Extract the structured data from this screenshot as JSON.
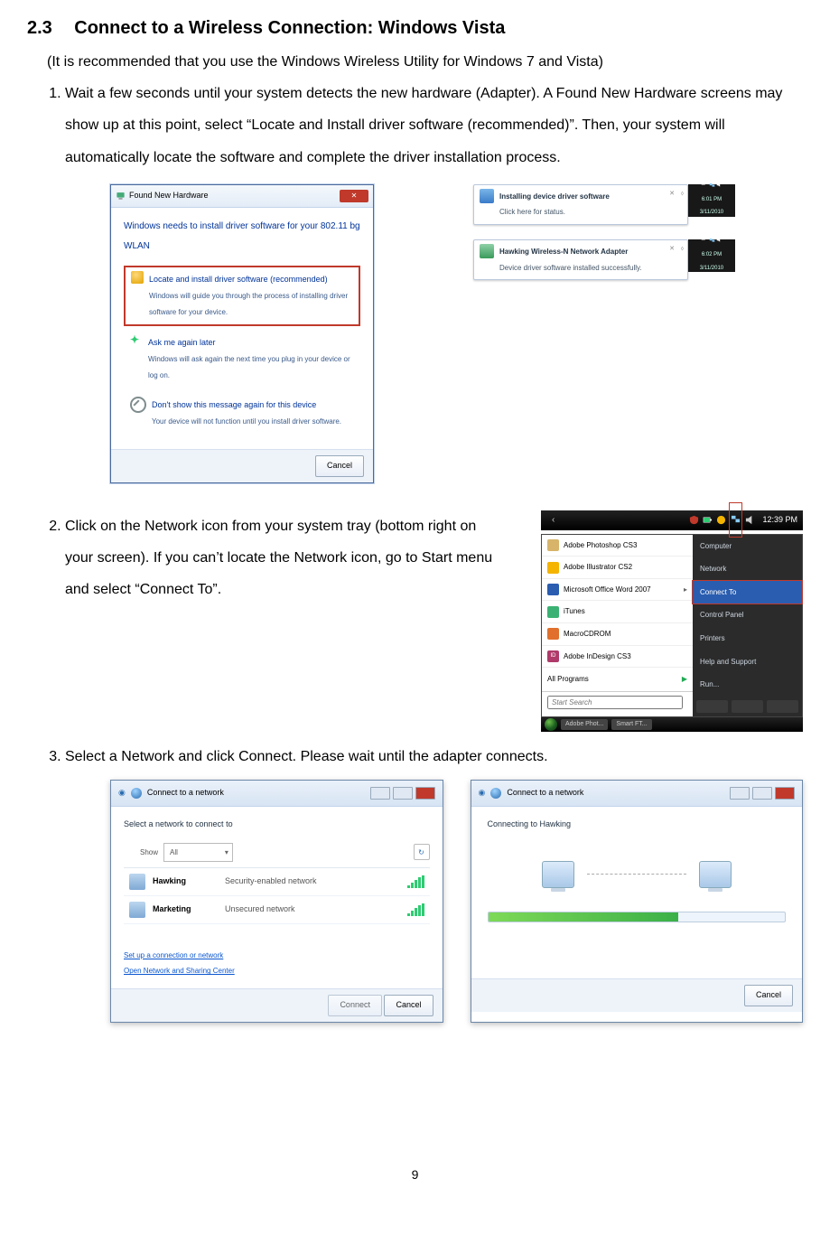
{
  "section": {
    "number": "2.3",
    "title": "Connect to a Wireless Connection: Windows Vista"
  },
  "recommendation": "(It is recommended that you use the Windows Wireless Utility for Windows 7 and Vista)",
  "steps": {
    "s1": "Wait a few seconds until your system detects the new hardware (Adapter).    A Found New Hardware screens may show up at this point, select “Locate and Install driver software (recommended)”.    Then, your system will automatically locate the software and complete the driver installation process.",
    "s2": "Click on the Network icon from your system tray (bottom right on your screen). If you can’t locate the Network icon, go to Start menu and select “Connect To”.",
    "s3": "Select a Network and click Connect. Please wait until the adapter connects."
  },
  "fnh": {
    "titlebar": "Found New Hardware",
    "heading": "Windows needs to install driver software for your 802.11 bg WLAN",
    "opt1_title": "Locate and install driver software (recommended)",
    "opt1_desc": "Windows will guide you through the process of installing driver software for your device.",
    "opt2_title": "Ask me again later",
    "opt2_desc": "Windows will ask again the next time you plug in your device or log on.",
    "opt3_title": "Don't show this message again for this device",
    "opt3_desc": "Your device will not function until you install driver software.",
    "cancel": "Cancel"
  },
  "balloons": {
    "b1_title": "Installing device driver software",
    "b1_desc": "Click here for status.",
    "b1_time": "6:01 PM",
    "b1_date": "3/11/2010",
    "b2_title": "Hawking Wireless-N Network Adapter",
    "b2_desc": "Device driver software installed successfully.",
    "b2_time": "6:02 PM",
    "b2_date": "3/11/2010"
  },
  "tray": {
    "clock": "12:39 PM"
  },
  "startmenu": {
    "left": {
      "i0": "Adobe Photoshop CS3",
      "i1": "Adobe Illustrator CS2",
      "i2": "Microsoft Office Word 2007",
      "i3": "iTunes",
      "i4": "MacroCDROM",
      "i5_badge": "ID",
      "i5": "Adobe InDesign CS3",
      "allprograms": "All Programs",
      "search_placeholder": "Start Search"
    },
    "right": {
      "r0": "Computer",
      "r1": "Network",
      "r2": "Connect To",
      "r3": "Control Panel",
      "r4": "Printers",
      "r5": "Help and Support",
      "r6": "Run..."
    },
    "taskbar": {
      "t1": "Adobe Phot...",
      "t2": "Smart FT..."
    }
  },
  "netdlg": {
    "title": "Connect to a network",
    "select_label": "Select a network to connect to",
    "show_label": "Show",
    "show_value": "All",
    "n1_name": "Hawking",
    "n1_type": "Security-enabled network",
    "n2_name": "Marketing",
    "n2_type": "Unsecured network",
    "link1": "Set up a connection or network",
    "link2": "Open Network and Sharing Center",
    "connect": "Connect",
    "cancel": "Cancel"
  },
  "conn": {
    "title": "Connect to a network",
    "label": "Connecting to Hawking",
    "cancel": "Cancel"
  },
  "page": "9"
}
